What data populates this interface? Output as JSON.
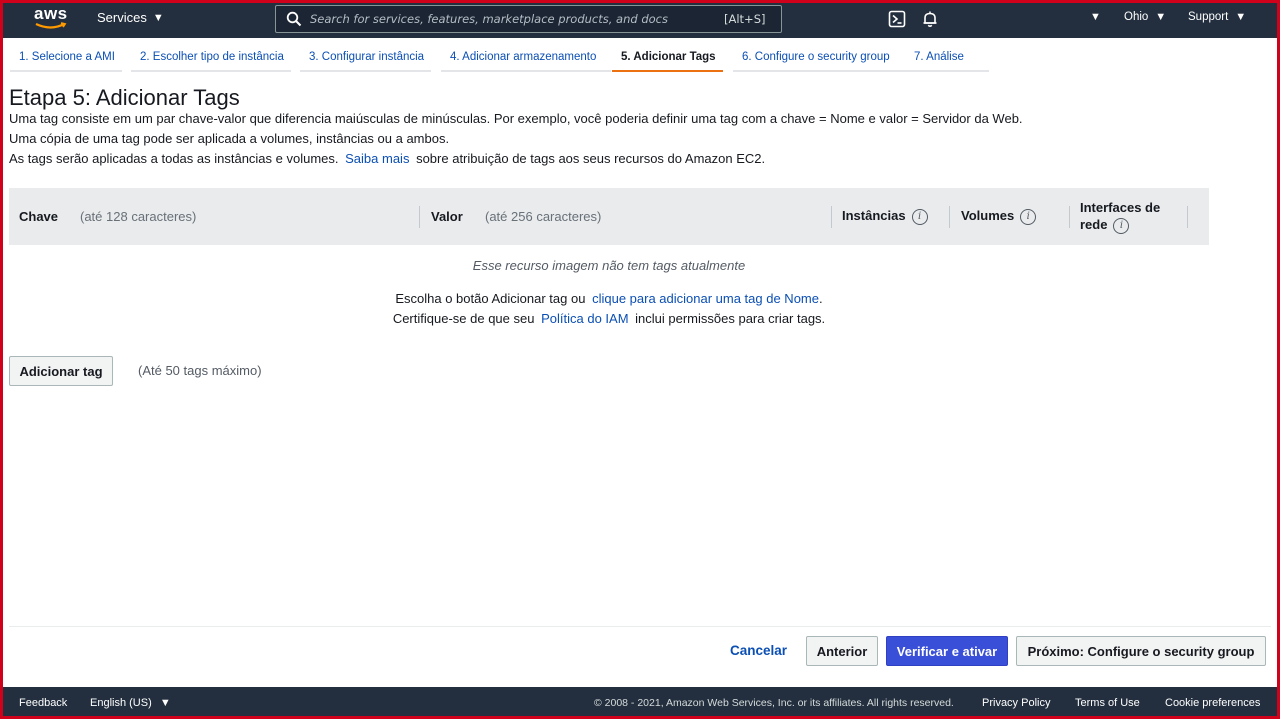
{
  "topnav": {
    "logo_text": "aws",
    "services_label": "Services",
    "search_placeholder": "Search for services, features, marketplace products, and docs",
    "search_shortcut": "[Alt+S]",
    "region_label": "Ohio",
    "support_label": "Support"
  },
  "wizard": {
    "tabs": [
      {
        "label": "1. Selecione a AMI"
      },
      {
        "label": "2. Escolher tipo de instância"
      },
      {
        "label": "3. Configurar instância"
      },
      {
        "label": "4. Adicionar armazenamento"
      },
      {
        "label": "5. Adicionar Tags"
      },
      {
        "label": "6. Configure o security group"
      },
      {
        "label": "7. Análise"
      }
    ],
    "active_index": 4
  },
  "page": {
    "title": "Etapa 5: Adicionar Tags",
    "desc1": "Uma tag consiste em um par chave-valor que diferencia maiúsculas de minúsculas. Por exemplo, você poderia definir uma tag com a chave = Nome e valor = Servidor da Web.",
    "desc2": "Uma cópia de uma tag pode ser aplicada a volumes, instâncias ou a ambos.",
    "desc3_pre": "As tags serão aplicadas a todas as instâncias e volumes.",
    "desc3_link": "Saiba mais",
    "desc3_post": "sobre atribuição de tags aos seus recursos do Amazon EC2."
  },
  "table": {
    "col_key": "Chave",
    "col_key_hint": "(até 128 caracteres)",
    "col_value": "Valor",
    "col_value_hint": "(até 256 caracteres)",
    "col_instances": "Instâncias",
    "col_volumes": "Volumes",
    "col_network_line1": "Interfaces de",
    "col_network_line2": "rede",
    "info_glyph": "i",
    "empty_message": "Esse recurso imagem não tem tags atualmente",
    "hint1_pre": "Escolha o botão Adicionar tag ou",
    "hint1_link": "clique para adicionar uma tag de Nome",
    "hint1_post": ".",
    "hint2_pre": "Certifique-se de que seu",
    "hint2_link": "Política do IAM",
    "hint2_post": "inclui permissões para criar tags."
  },
  "actions": {
    "add_tag": "Adicionar tag",
    "max_note": "(Até 50 tags máximo)",
    "cancel": "Cancelar",
    "previous": "Anterior",
    "review_launch": "Verificar e ativar",
    "next": "Próximo: Configure o security group"
  },
  "footer": {
    "feedback": "Feedback",
    "language": "English (US)",
    "copyright": "© 2008 - 2021, Amazon Web Services, Inc. or its affiliates. All rights reserved.",
    "privacy": "Privacy Policy",
    "terms": "Terms of Use",
    "cookies": "Cookie preferences"
  },
  "colors": {
    "nav_bg": "#232f3e",
    "link": "#0b4fb4",
    "primary_button": "#3a4fd8",
    "active_tab_underline": "#ec7211"
  },
  "icons": [
    "search-icon",
    "cloudshell-icon",
    "bell-icon",
    "caret-down-icon",
    "info-icon"
  ]
}
